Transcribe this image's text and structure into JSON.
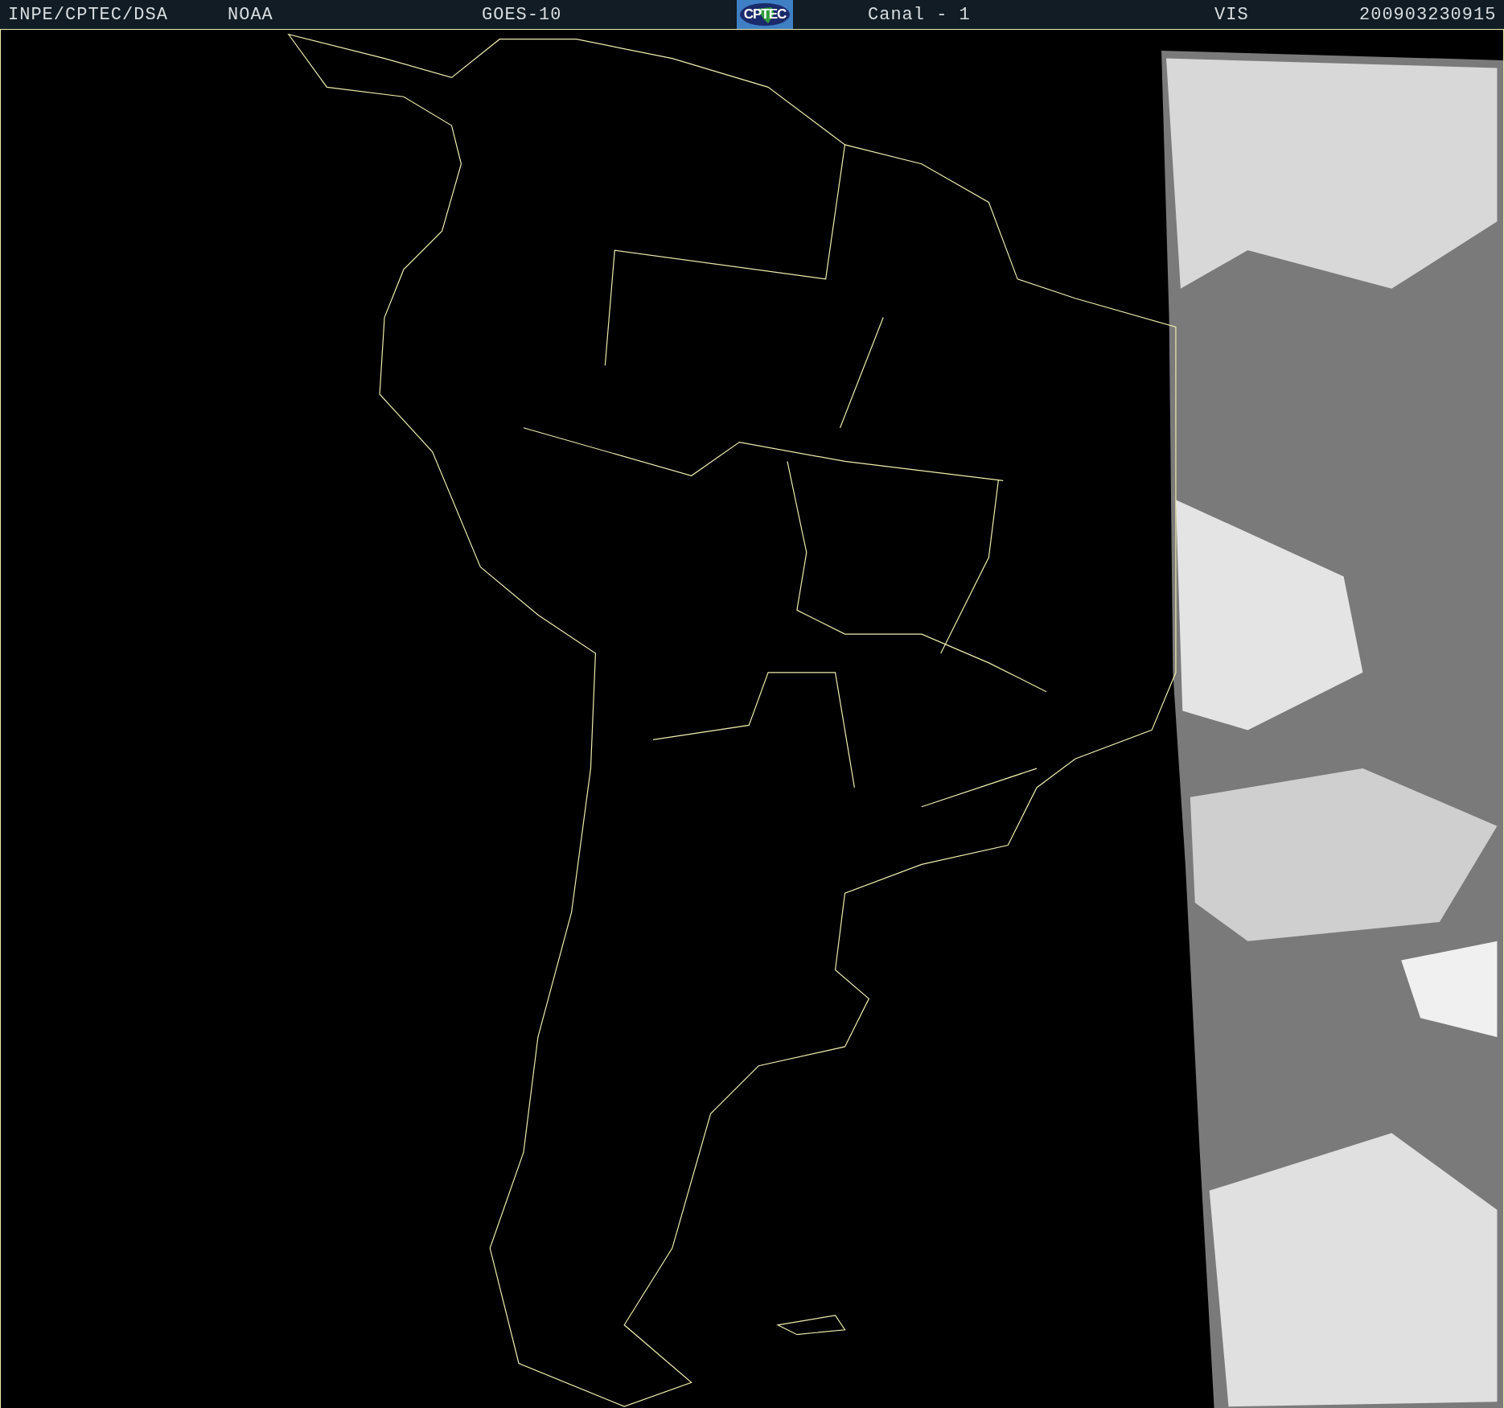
{
  "header": {
    "items": [
      {
        "kind": "text",
        "text": "INPE/CPTEC/DSA"
      },
      {
        "kind": "text",
        "text": "NOAA"
      },
      {
        "kind": "text",
        "text": "GOES-10"
      },
      {
        "kind": "logo",
        "text": "CPTEC"
      },
      {
        "kind": "text",
        "text": "Canal - 1"
      },
      {
        "kind": "text",
        "text": "VIS"
      },
      {
        "kind": "text",
        "text": "200903230915"
      }
    ]
  }
}
